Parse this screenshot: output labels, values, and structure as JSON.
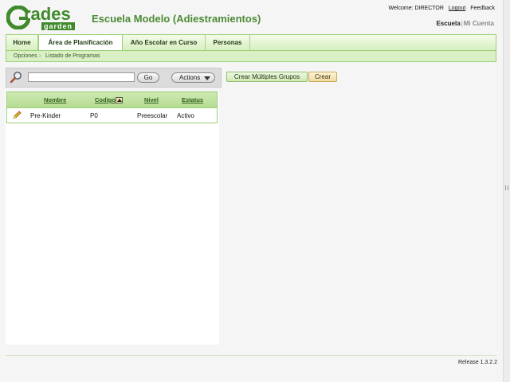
{
  "header": {
    "logo_main": "rades",
    "logo_sub": "garden",
    "school_title": "Escuela Modelo (Adiestramientos)",
    "welcome": "Welcome: DIRECTOR",
    "logout": "Logout",
    "feedback": "Feedback",
    "school_current": "Escuela",
    "school_separator": "|",
    "school_other": "Mi Cuenta"
  },
  "nav": {
    "tabs": [
      {
        "label": "Home"
      },
      {
        "label": "Área de Planificación"
      },
      {
        "label": "Año Escolar en Curso"
      },
      {
        "label": "Personas"
      }
    ],
    "active_tab": "Área de Planificación"
  },
  "breadcrumb": {
    "items": [
      "Opciones",
      "Listado de Programas"
    ],
    "separator": "›"
  },
  "toolbar": {
    "search_value": "",
    "go_label": "Go",
    "actions_label": "Actions",
    "multi_groups_label": "Crear Múltiples Grupos",
    "create_label": "Crear"
  },
  "table": {
    "columns": [
      "Nombre",
      "Codigo",
      "Nivel",
      "Estatus"
    ],
    "sorted_column": "Codigo",
    "rows": [
      {
        "nombre": "Pre-Kinder",
        "codigo": "P0",
        "nivel": "Preescolar",
        "estatus": "Activo"
      }
    ]
  },
  "footer": {
    "release": "Release 1.3.2.2"
  },
  "colors": {
    "brand_green": "#3f8a2c",
    "nav_border": "#9ccf75",
    "create_button": "#f1dba0"
  }
}
